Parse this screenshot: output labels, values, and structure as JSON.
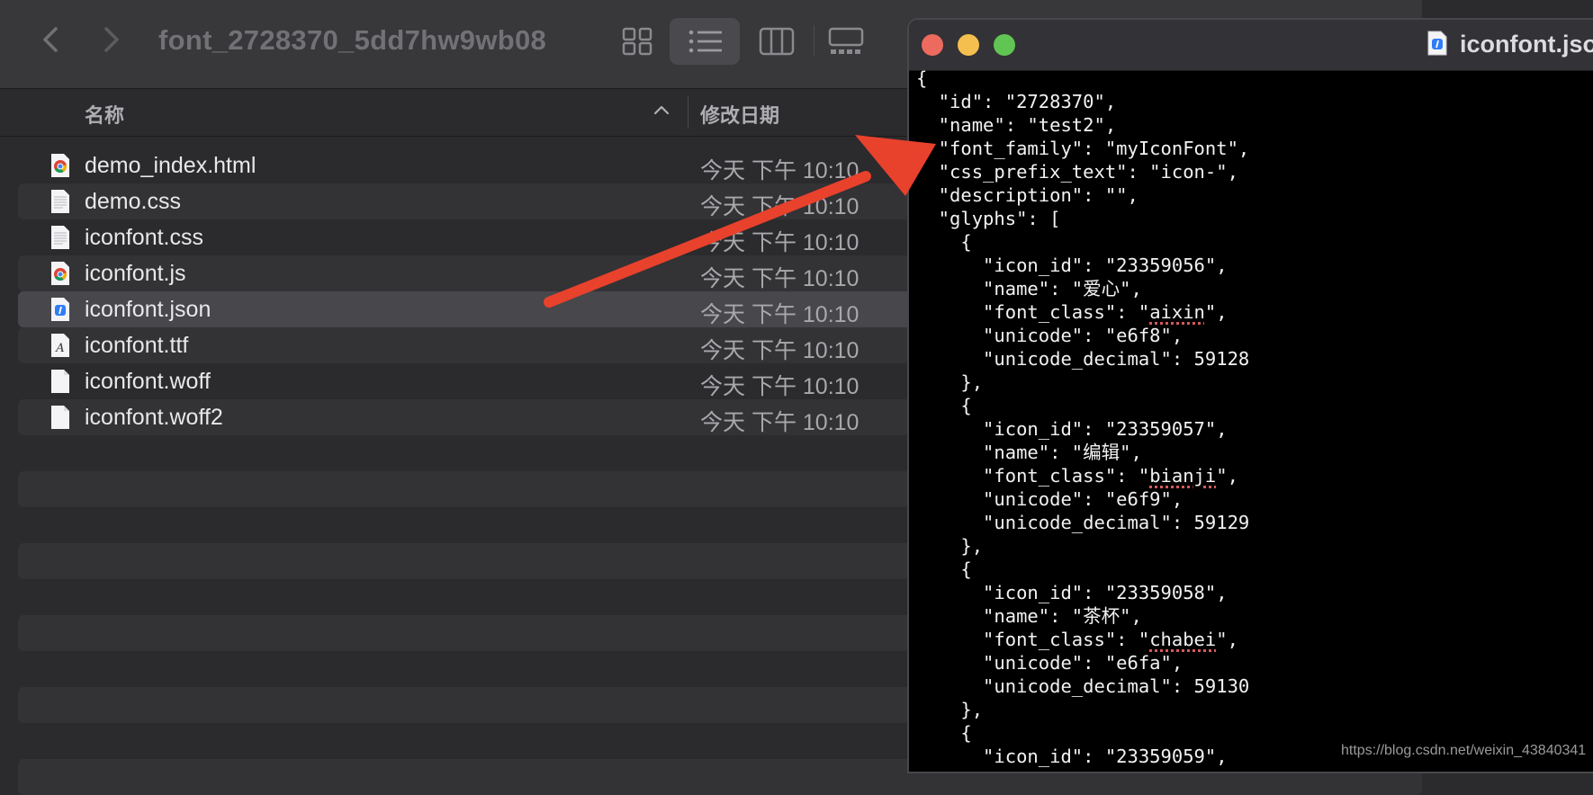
{
  "finder": {
    "title": "font_2728370_5dd7hw9wb08",
    "columns": {
      "name": "名称",
      "date": "修改日期"
    },
    "files": [
      {
        "name": "demo_index.html",
        "date": "今天 下午 10:10",
        "icon": "chrome-icon"
      },
      {
        "name": "demo.css",
        "date": "今天 下午 10:10",
        "icon": "text-doc-icon"
      },
      {
        "name": "iconfont.css",
        "date": "今天 下午 10:10",
        "icon": "text-doc-icon"
      },
      {
        "name": "iconfont.js",
        "date": "今天 下午 10:10",
        "icon": "chrome-icon"
      },
      {
        "name": "iconfont.json",
        "date": "今天 下午 10:10",
        "icon": "json-doc-icon"
      },
      {
        "name": "iconfont.ttf",
        "date": "今天 下午 10:10",
        "icon": "font-doc-icon"
      },
      {
        "name": "iconfont.woff",
        "date": "今天 下午 10:10",
        "icon": "blank-doc-icon"
      },
      {
        "name": "iconfont.woff2",
        "date": "今天 下午 10:10",
        "icon": "blank-doc-icon"
      }
    ],
    "selected_file_index": 4
  },
  "editor": {
    "title": "iconfont.json",
    "lines": [
      "{",
      "  \"id\": \"2728370\",",
      "  \"name\": \"test2\",",
      "  \"font_family\": \"myIconFont\",",
      "  \"css_prefix_text\": \"icon-\",",
      "  \"description\": \"\",",
      "  \"glyphs\": [",
      "    {",
      "      \"icon_id\": \"23359056\",",
      "      \"name\": \"爱心\",",
      "      \"font_class\": \"aixin\",",
      "      \"unicode\": \"e6f8\",",
      "      \"unicode_decimal\": 59128",
      "    },",
      "    {",
      "      \"icon_id\": \"23359057\",",
      "      \"name\": \"编辑\",",
      "      \"font_class\": \"bianji\",",
      "      \"unicode\": \"e6f9\",",
      "      \"unicode_decimal\": 59129",
      "    },",
      "    {",
      "      \"icon_id\": \"23359058\",",
      "      \"name\": \"茶杯\",",
      "      \"font_class\": \"chabei\",",
      "      \"unicode\": \"e6fa\",",
      "      \"unicode_decimal\": 59130",
      "    },",
      "    {",
      "      \"icon_id\": \"23359059\","
    ],
    "misspelled_words": [
      "aixin",
      "bianji",
      "chabei"
    ]
  },
  "watermark": "https://blog.csdn.net/weixin_43840341",
  "colors": {
    "arrow": "#e8412c",
    "finder_bg": "#2b2a2d",
    "editor_bg": "#000000",
    "selection": "#48474b"
  }
}
